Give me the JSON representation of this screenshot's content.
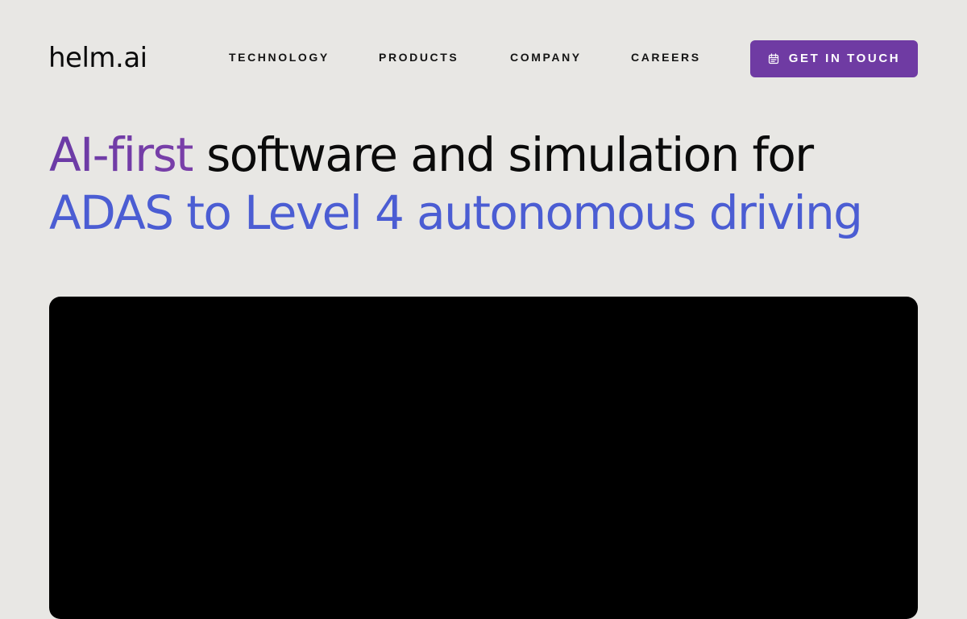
{
  "header": {
    "logo": "helm.ai",
    "nav": [
      {
        "label": "TECHNOLOGY"
      },
      {
        "label": "PRODUCTS"
      },
      {
        "label": "COMPANY"
      },
      {
        "label": "CAREERS"
      }
    ],
    "cta": {
      "label": "GET IN TOUCH",
      "icon": "calendar-icon"
    }
  },
  "hero": {
    "accent": "AI-first",
    "line1_rest": " software and simulation for",
    "line2": "ADAS to Level 4 autonomous driving"
  },
  "colors": {
    "background": "#e8e7e4",
    "text": "#0b0b0b",
    "accent_purple": "#6f3ba3",
    "accent_blue": "#4b5dd3",
    "video_panel": "#000000"
  }
}
